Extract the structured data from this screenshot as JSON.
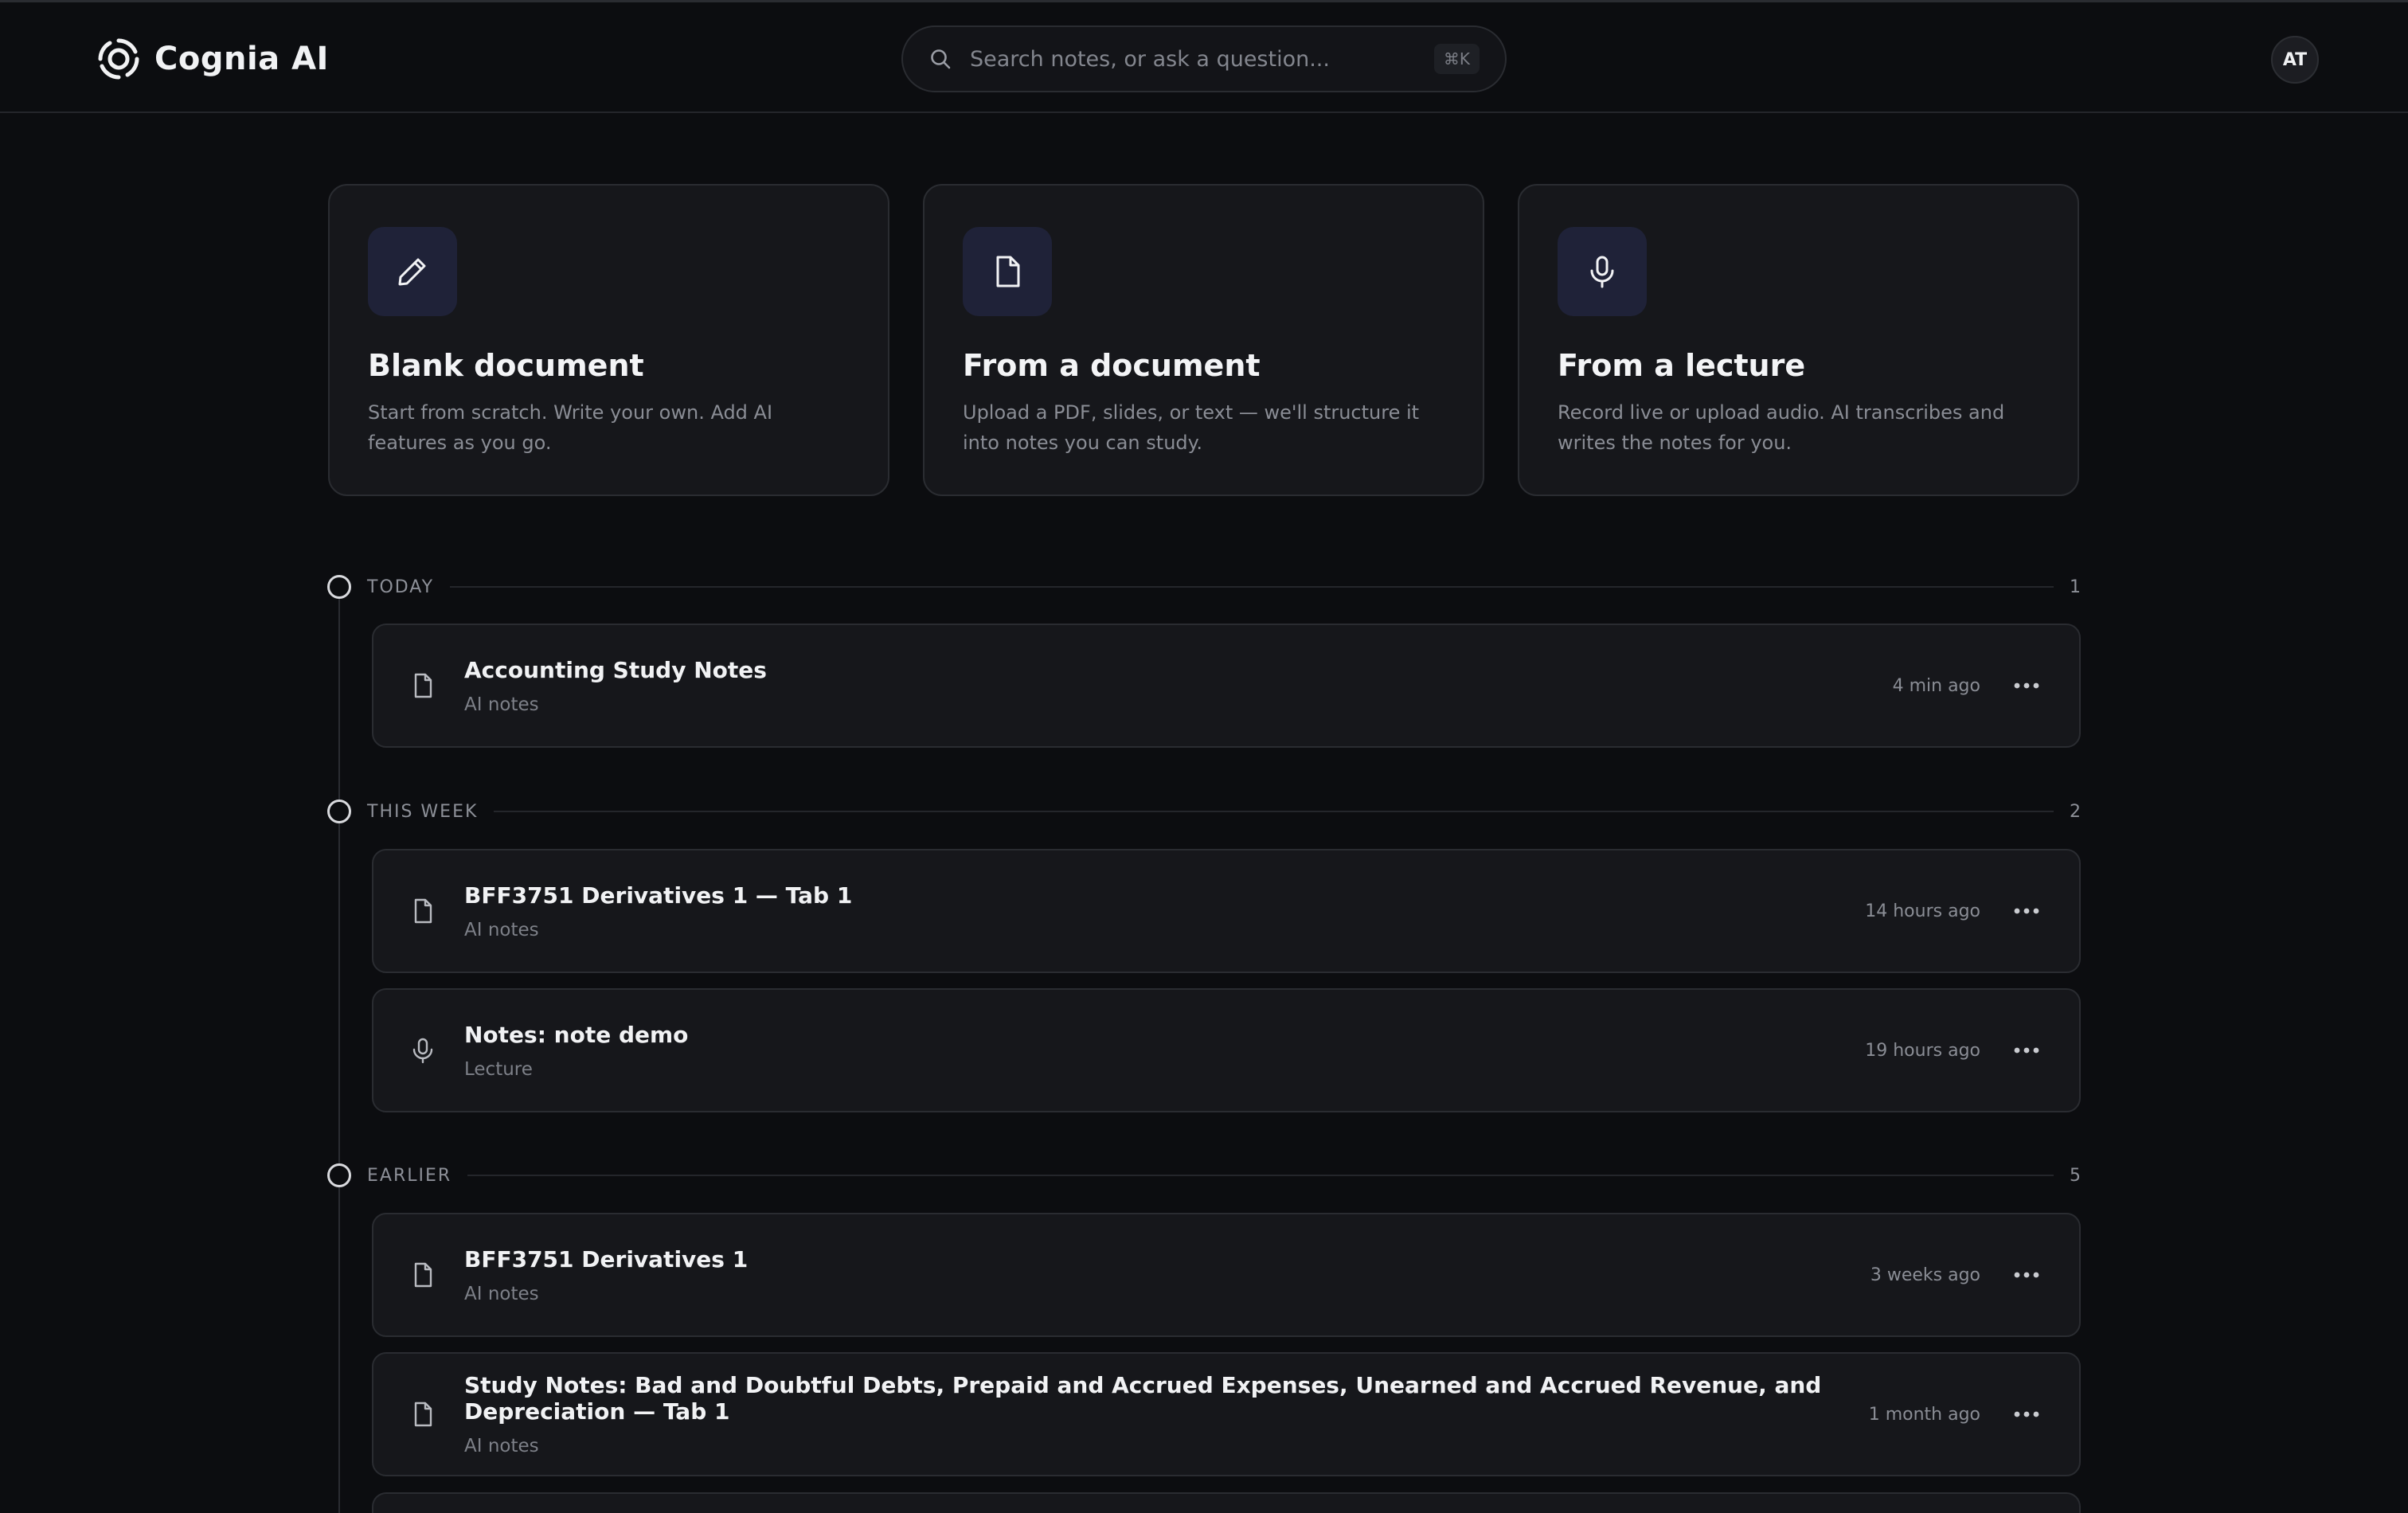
{
  "brand": {
    "name": "Cognia AI"
  },
  "search": {
    "placeholder": "Search notes, or ask a question...",
    "shortcut": "⌘K"
  },
  "user": {
    "initials": "AT"
  },
  "cards": [
    {
      "icon": "pencil-icon",
      "title": "Blank document",
      "description": "Start from scratch. Write your own. Add AI features as you go."
    },
    {
      "icon": "file-icon",
      "title": "From a document",
      "description": "Upload a PDF, slides, or text — we'll structure it into notes you can study."
    },
    {
      "icon": "microphone-icon",
      "title": "From a lecture",
      "description": "Record live or upload audio. AI transcribes and writes the notes for you."
    }
  ],
  "sections": [
    {
      "label": "TODAY",
      "count": "1",
      "notes": [
        {
          "icon": "file-icon",
          "title": "Accounting Study Notes",
          "type": "AI notes",
          "time": "4 min ago"
        }
      ]
    },
    {
      "label": "THIS WEEK",
      "count": "2",
      "notes": [
        {
          "icon": "file-icon",
          "title": "BFF3751 Derivatives 1 — Tab 1",
          "type": "AI notes",
          "time": "14 hours ago"
        },
        {
          "icon": "microphone-icon",
          "title": "Notes: note demo",
          "type": "Lecture",
          "time": "19 hours ago"
        }
      ]
    },
    {
      "label": "EARLIER",
      "count": "5",
      "notes": [
        {
          "icon": "file-icon",
          "title": "BFF3751 Derivatives 1",
          "type": "AI notes",
          "time": "3 weeks ago"
        },
        {
          "icon": "file-icon",
          "title": "Study Notes: Bad and Doubtful Debts, Prepaid and Accrued Expenses, Unearned and Accrued Revenue, and Depreciation — Tab 1",
          "type": "AI notes",
          "time": "1 month ago"
        }
      ]
    }
  ],
  "colors": {
    "background": "#0c0d10",
    "card": "#16171b",
    "icon_tile": "#1f2238",
    "border": "#2a2c31"
  }
}
